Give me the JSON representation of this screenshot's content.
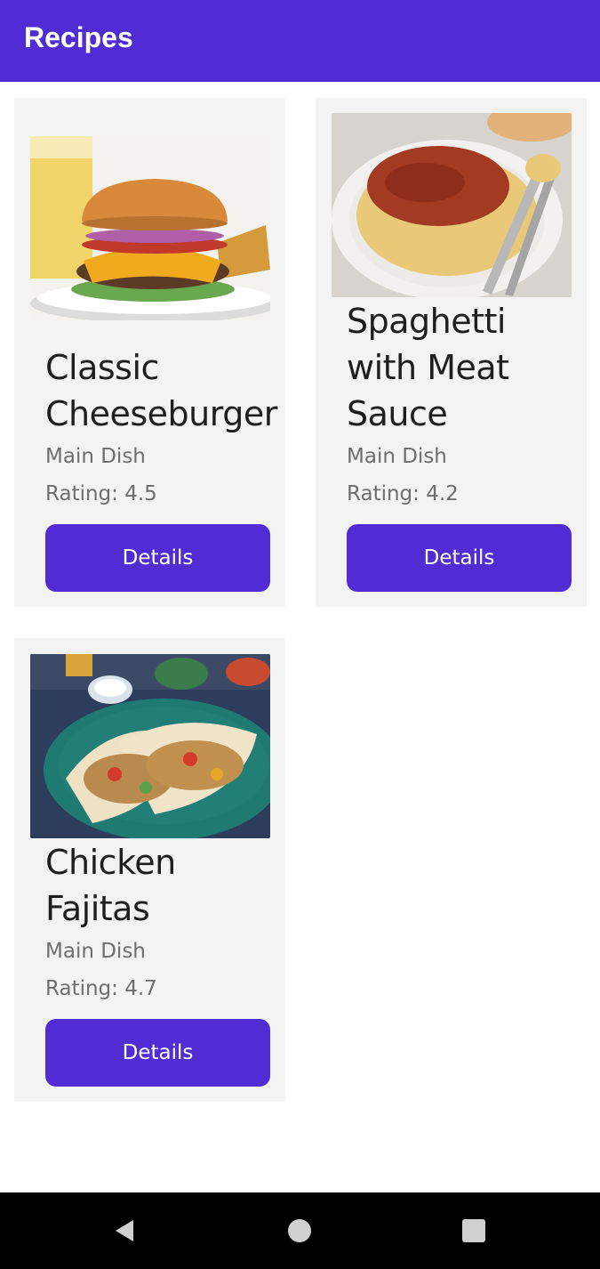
{
  "app_bar": {
    "title": "Recipes"
  },
  "recipes": [
    {
      "name": "Classic Cheeseburger",
      "category": "Main Dish",
      "rating": "Rating: 4.5",
      "button": "Details",
      "image": "cheeseburger-photo"
    },
    {
      "name": "Spaghetti with Meat Sauce",
      "category": "Main Dish",
      "rating": "Rating: 4.2",
      "button": "Details",
      "image": "spaghetti-photo"
    },
    {
      "name": "Chicken Fajitas",
      "category": "Main Dish",
      "rating": "Rating: 4.7",
      "button": "Details",
      "image": "fajitas-photo"
    }
  ],
  "nav": {
    "back": "back-icon",
    "home": "home-icon",
    "recents": "recents-icon"
  },
  "colors": {
    "accent": "#512bd4",
    "card_bg": "#f3f3f3",
    "nav_bg": "#000000"
  }
}
